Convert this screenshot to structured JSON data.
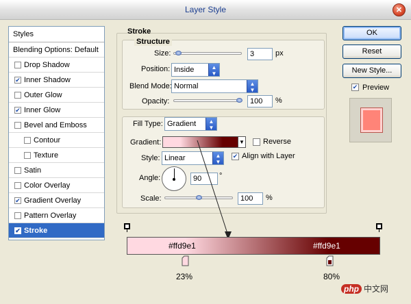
{
  "window": {
    "title": "Layer Style"
  },
  "left_panel": {
    "header": "Styles",
    "blending": "Blending Options: Default",
    "items": [
      {
        "label": "Drop Shadow",
        "checked": false,
        "sub": false
      },
      {
        "label": "Inner Shadow",
        "checked": true,
        "sub": false
      },
      {
        "label": "Outer Glow",
        "checked": false,
        "sub": false
      },
      {
        "label": "Inner Glow",
        "checked": true,
        "sub": false
      },
      {
        "label": "Bevel and Emboss",
        "checked": false,
        "sub": false
      },
      {
        "label": "Contour",
        "checked": false,
        "sub": true
      },
      {
        "label": "Texture",
        "checked": false,
        "sub": true
      },
      {
        "label": "Satin",
        "checked": false,
        "sub": false
      },
      {
        "label": "Color Overlay",
        "checked": false,
        "sub": false
      },
      {
        "label": "Gradient Overlay",
        "checked": true,
        "sub": false
      },
      {
        "label": "Pattern Overlay",
        "checked": false,
        "sub": false
      },
      {
        "label": "Stroke",
        "checked": true,
        "sub": false,
        "selected": true
      }
    ]
  },
  "stroke": {
    "title": "Stroke",
    "structure": {
      "legend": "Structure",
      "size_label": "Size:",
      "size_value": "3",
      "size_unit": "px",
      "size_slider_level": 0.03,
      "position_label": "Position:",
      "position_value": "Inside",
      "blend_label": "Blend Mode:",
      "blend_value": "Normal",
      "opacity_label": "Opacity:",
      "opacity_value": "100",
      "opacity_unit": "%",
      "opacity_slider_level": 1.0
    },
    "fill": {
      "filltype_label": "Fill Type:",
      "filltype_value": "Gradient",
      "gradient_label": "Gradient:",
      "reverse_label": "Reverse",
      "reverse_checked": false,
      "style_label": "Style:",
      "style_value": "Linear",
      "align_label": "Align with Layer",
      "align_checked": true,
      "angle_label": "Angle:",
      "angle_value": "90",
      "angle_unit": "°",
      "scale_label": "Scale:",
      "scale_value": "100",
      "scale_unit": "%",
      "scale_slider_level": 0.5
    }
  },
  "buttons": {
    "ok": "OK",
    "reset": "Reset",
    "new_style": "New Style...",
    "preview_label": "Preview",
    "preview_checked": true
  },
  "gradient_editor": {
    "color_left": "#ffd9e1",
    "color_right": "#660000",
    "label_left": "#ffd9e1",
    "label_right": "#ffd9e1",
    "stop_left_pct": "23%",
    "stop_right_pct": "80%"
  },
  "watermark": {
    "badge": "php",
    "text": "中文网"
  }
}
